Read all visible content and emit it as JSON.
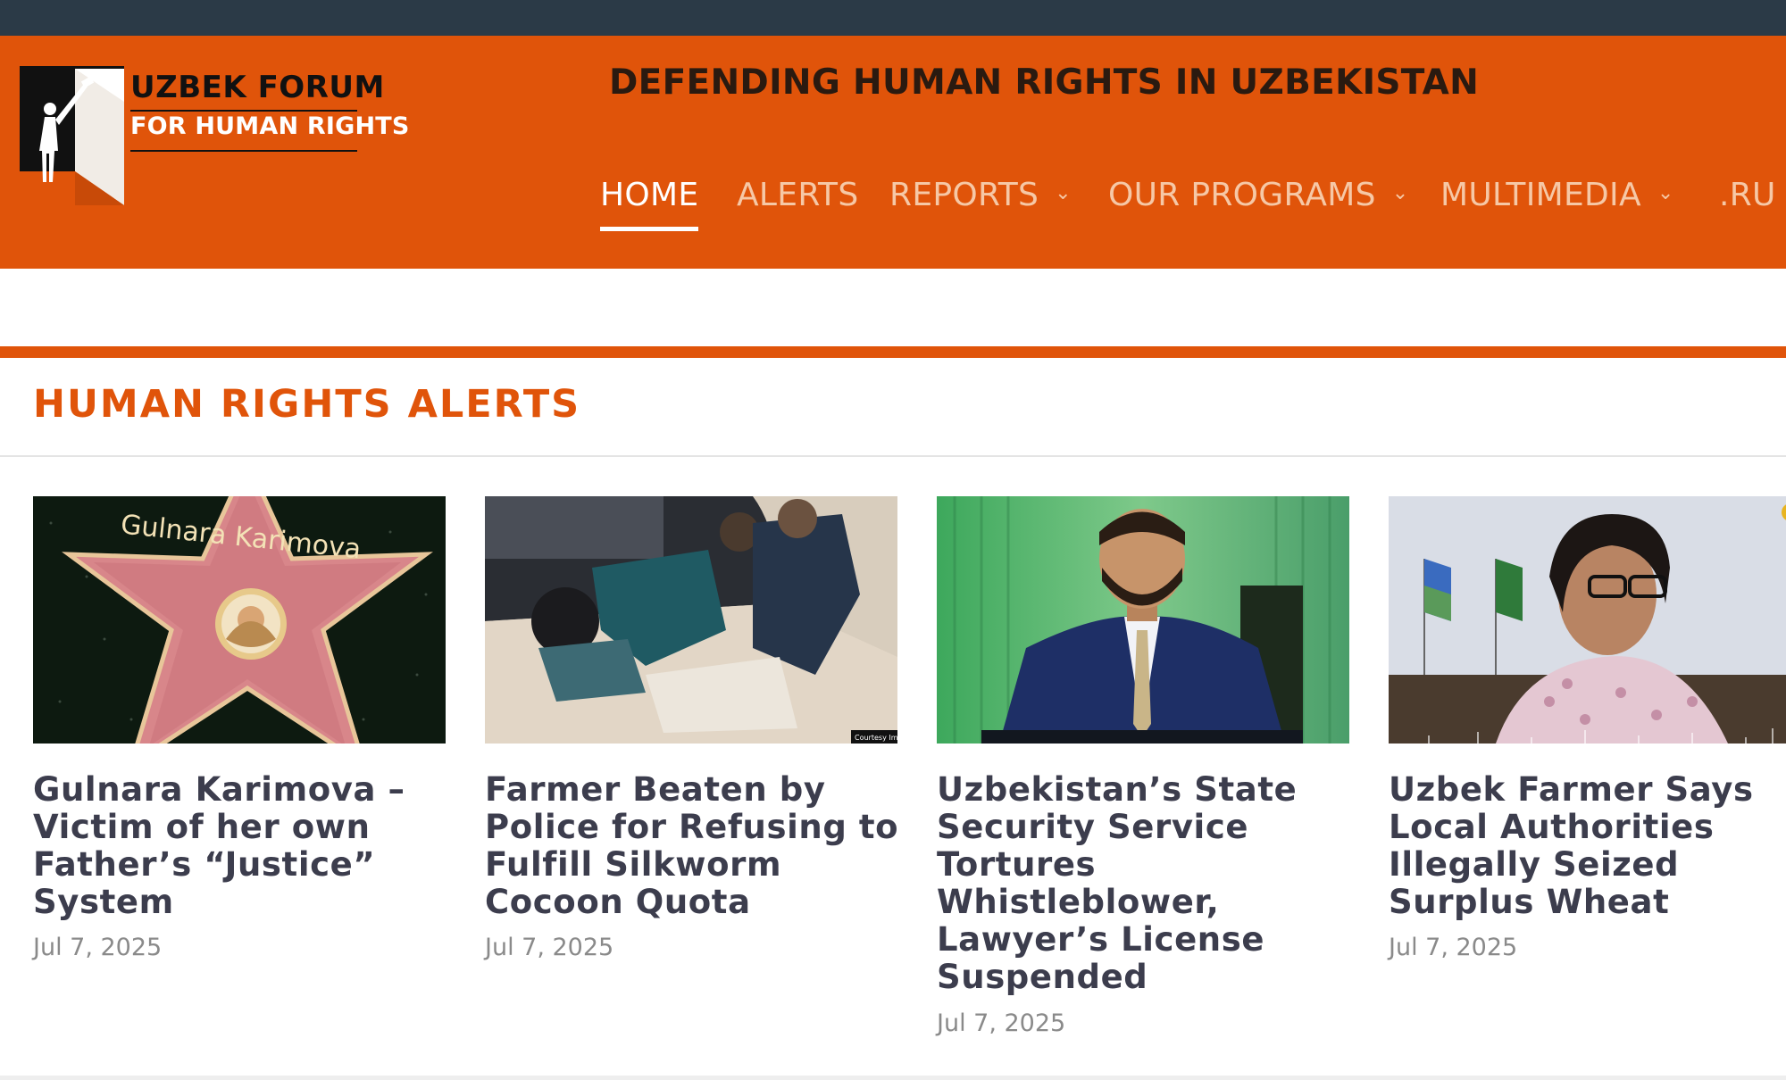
{
  "site": {
    "logo_line1": "UZBEK FORUM",
    "logo_line2": "FOR HUMAN RIGHTS",
    "tagline": "DEFENDING HUMAN RIGHTS IN UZBEKISTAN"
  },
  "nav": {
    "items": [
      {
        "label": "HOME",
        "active": true,
        "dropdown": false
      },
      {
        "label": "ALERTS",
        "active": false,
        "dropdown": false
      },
      {
        "label": "REPORTS",
        "active": false,
        "dropdown": true
      },
      {
        "label": "OUR PROGRAMS",
        "active": false,
        "dropdown": true
      },
      {
        "label": "MULTIMEDIA",
        "active": false,
        "dropdown": true
      },
      {
        "label": ".RU",
        "active": false,
        "dropdown": false
      }
    ],
    "chevron_icon": "chevron-down-icon"
  },
  "section": {
    "title": "HUMAN RIGHTS ALERTS"
  },
  "cards": [
    {
      "image_text": "Gulnara Karimova",
      "title": "Gulnara Karimova – Victim of her own Father’s “Justice” System",
      "date": "Jul 7, 2025"
    },
    {
      "image_text": "Courtesy Im",
      "title": "Farmer Beaten by Police for Refusing to Fulfill Silkworm Cocoon Quota",
      "date": "Jul 7, 2025"
    },
    {
      "title": "Uzbekistan’s State Security Service Tortures Whistleblower, Lawyer’s License Suspended",
      "date": "Jul 7, 2025"
    },
    {
      "title": "Uzbek Farmer Says Local Authorities Illegally Seized Surplus Wheat",
      "date": "Jul 7, 2025"
    }
  ],
  "colors": {
    "brand_orange": "#e0540a",
    "top_bar": "#2b3a47",
    "title_text": "#3c3d4d",
    "date_text": "#8a8a8a"
  }
}
